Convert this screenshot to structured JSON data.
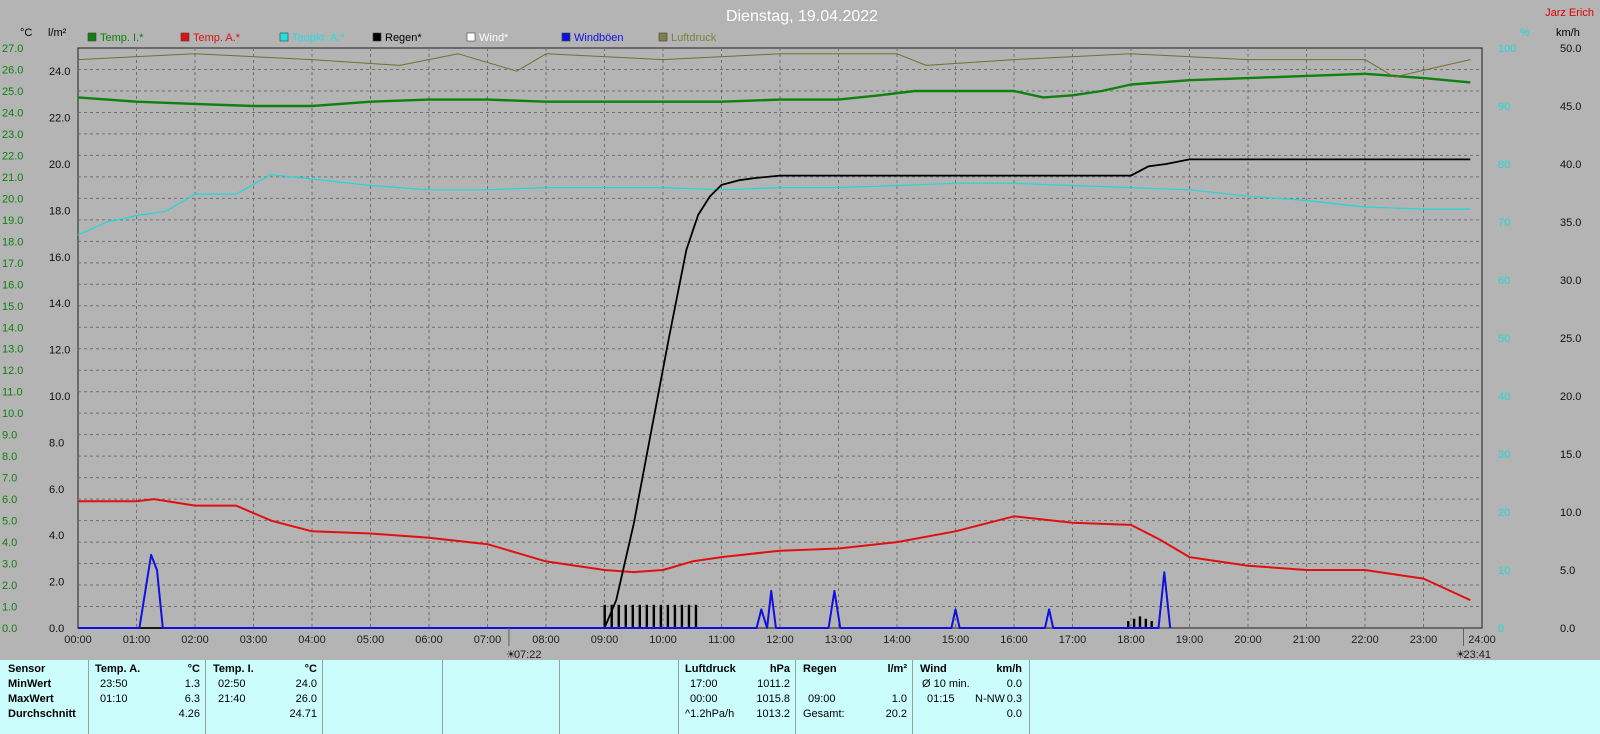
{
  "header": {
    "title": "Dienstag, 19.04.2022",
    "author": "Jarz Erich"
  },
  "legend": [
    {
      "label": "Temp. I.*",
      "color": "#108010"
    },
    {
      "label": "Temp. A.*",
      "color": "#e01010"
    },
    {
      "label": "Taupkt. A.*",
      "color": "#20e0e0"
    },
    {
      "label": "Regen*",
      "color": "#000000"
    },
    {
      "label": "Wind*",
      "color": "#ffffff"
    },
    {
      "label": "Windböen",
      "color": "#1010e0"
    },
    {
      "label": "Luftdruck",
      "color": "#808040"
    }
  ],
  "units": {
    "temp": "°C",
    "rain": "l/m²",
    "humidity": "%",
    "wind": "km/h"
  },
  "colors": {
    "temp_in": "#108010",
    "temp_out": "#e01010",
    "dew": "#20d8d8",
    "rain": "#000000",
    "gust": "#1010e0",
    "pressure": "#707030",
    "plot_bg": "#b4b4b4",
    "grid": "#707070"
  },
  "markers": {
    "sunrise": "07:22",
    "sunset": "23:41"
  },
  "chart_data": {
    "type": "line",
    "x_unit": "hour of day",
    "x_ticks": [
      "00:00",
      "01:00",
      "02:00",
      "03:00",
      "04:00",
      "05:00",
      "06:00",
      "07:00",
      "08:00",
      "09:00",
      "10:00",
      "11:00",
      "12:00",
      "13:00",
      "14:00",
      "15:00",
      "16:00",
      "17:00",
      "18:00",
      "19:00",
      "20:00",
      "21:00",
      "22:00",
      "23:00",
      "24:00"
    ],
    "axes": {
      "temp_ticks": [
        "27.0",
        "26.0",
        "25.0",
        "24.0",
        "23.0",
        "22.0",
        "21.0",
        "20.0",
        "19.0",
        "18.0",
        "17.0",
        "16.0",
        "15.0",
        "14.0",
        "13.0",
        "12.0",
        "11.0",
        "10.0",
        "9.0",
        "8.0",
        "7.0",
        "6.0",
        "5.0",
        "4.0",
        "3.0",
        "2.0",
        "1.0",
        "0.0"
      ],
      "rain_ticks": [
        "24.0",
        "22.0",
        "20.0",
        "18.0",
        "16.0",
        "14.0",
        "12.0",
        "10.0",
        "8.0",
        "6.0",
        "4.0",
        "2.0",
        "0.0"
      ],
      "humidity_ticks": [
        "100",
        "90",
        "80",
        "70",
        "60",
        "50",
        "40",
        "30",
        "20",
        "10",
        "0"
      ],
      "wind_ticks": [
        "50.0",
        "45.0",
        "40.0",
        "35.0",
        "30.0",
        "25.0",
        "20.0",
        "15.0",
        "10.0",
        "5.0",
        "0.0"
      ],
      "rain_range": [
        0,
        25
      ],
      "wind_range": [
        0,
        50
      ],
      "grid": true
    },
    "series": [
      {
        "name": "Temp. I.",
        "axis": "temp",
        "x": [
          0,
          1,
          2,
          3,
          4,
          5,
          6,
          7,
          8,
          9,
          10,
          11,
          12,
          13,
          13.7,
          14.3,
          15,
          16,
          16.5,
          17,
          17.5,
          18,
          19,
          20,
          21,
          22,
          23,
          23.8
        ],
        "y": [
          24.7,
          24.5,
          24.4,
          24.3,
          24.3,
          24.5,
          24.6,
          24.6,
          24.5,
          24.5,
          24.5,
          24.5,
          24.6,
          24.6,
          24.8,
          25.0,
          25.0,
          25.0,
          24.7,
          24.8,
          25.0,
          25.3,
          25.5,
          25.6,
          25.7,
          25.8,
          25.6,
          25.4
        ]
      },
      {
        "name": "Temp. A.",
        "axis": "temp",
        "x": [
          0,
          1,
          1.3,
          2,
          2.7,
          3.3,
          4,
          5,
          6,
          7,
          7.5,
          8,
          9,
          9.5,
          10,
          10.5,
          11,
          12,
          13,
          14,
          15,
          16,
          17,
          18,
          18.5,
          19,
          20,
          21,
          22,
          23,
          23.8
        ],
        "y": [
          5.9,
          5.9,
          6.0,
          5.7,
          5.7,
          5.0,
          4.5,
          4.4,
          4.2,
          3.9,
          3.5,
          3.1,
          2.7,
          2.6,
          2.7,
          3.1,
          3.3,
          3.6,
          3.7,
          4.0,
          4.5,
          5.2,
          4.9,
          4.8,
          4.1,
          3.3,
          2.9,
          2.7,
          2.7,
          2.3,
          1.3
        ]
      },
      {
        "name": "Taupkt. A.",
        "axis": "temp",
        "x": [
          0,
          0.5,
          1,
          1.5,
          2,
          2.7,
          3.3,
          4,
          5,
          6,
          7,
          8,
          9,
          10,
          11,
          12,
          13,
          14,
          15,
          16,
          17,
          18,
          19,
          20,
          21,
          22,
          23,
          23.8
        ],
        "y": [
          18.3,
          18.9,
          19.2,
          19.4,
          20.2,
          20.2,
          21.1,
          20.9,
          20.6,
          20.4,
          20.4,
          20.5,
          20.5,
          20.5,
          20.4,
          20.5,
          20.5,
          20.6,
          20.7,
          20.7,
          20.6,
          20.5,
          20.4,
          20.1,
          19.9,
          19.6,
          19.5,
          19.5
        ]
      },
      {
        "name": "Regen",
        "axis": "rain",
        "x": [
          0,
          9,
          9.2,
          9.5,
          9.8,
          10.1,
          10.4,
          10.6,
          10.8,
          11,
          11.3,
          11.6,
          12,
          13,
          14,
          15,
          16,
          17,
          18,
          18.3,
          18.6,
          19,
          20,
          21,
          22,
          23,
          23.8
        ],
        "y": [
          0,
          0,
          1.2,
          4.5,
          8.5,
          12.5,
          16.3,
          17.8,
          18.6,
          19.1,
          19.3,
          19.4,
          19.5,
          19.5,
          19.5,
          19.5,
          19.5,
          19.5,
          19.5,
          19.9,
          20.0,
          20.2,
          20.2,
          20.2,
          20.2,
          20.2,
          20.2
        ]
      },
      {
        "name": "Windböen",
        "axis": "wind",
        "x": [
          0,
          1.05,
          1.25,
          1.35,
          1.45,
          11.6,
          11.68,
          11.78,
          11.85,
          11.93,
          12.83,
          12.93,
          13.03,
          14.93,
          15.0,
          15.07,
          16.53,
          16.6,
          16.67,
          18.47,
          18.57,
          18.67
        ],
        "y": [
          0,
          0,
          6.3,
          5.0,
          0,
          0,
          1.6,
          0,
          3.2,
          0,
          0,
          3.2,
          0,
          0,
          1.6,
          0,
          0,
          1.6,
          0,
          0,
          4.8,
          0
        ]
      },
      {
        "name": "Luftdruck",
        "axis": "humidity",
        "x": [
          0,
          2,
          4,
          5.5,
          6.5,
          7.5,
          8,
          10,
          12,
          14,
          14.5,
          16,
          18,
          20,
          22,
          22.5,
          23.8
        ],
        "y": [
          98,
          99,
          98,
          97,
          99,
          96,
          99,
          98,
          99,
          99,
          97,
          98,
          99,
          98,
          98,
          95,
          98
        ]
      }
    ],
    "rain_bars": {
      "x": [
        9.0,
        9.12,
        9.24,
        9.36,
        9.48,
        9.6,
        9.72,
        9.84,
        9.96,
        10.08,
        10.2,
        10.32,
        10.44,
        10.56,
        17.95,
        18.05,
        18.15,
        18.25,
        18.35
      ],
      "y": [
        1.0,
        1.0,
        1.0,
        1.0,
        1.0,
        1.0,
        1.0,
        1.0,
        1.0,
        1.0,
        1.0,
        1.0,
        1.0,
        1.0,
        0.3,
        0.4,
        0.5,
        0.4,
        0.3
      ]
    }
  },
  "panel": {
    "col1": {
      "header": "Sensor",
      "rows": [
        "MinWert",
        "MaxWert",
        "Durchschnitt"
      ]
    },
    "col2": {
      "header": "Temp. A.",
      "unit": "°C",
      "times": [
        "23:50",
        "01:10",
        ""
      ],
      "values": [
        "1.3",
        "6.3",
        "4.26"
      ]
    },
    "col3": {
      "header": "Temp. I.",
      "unit": "°C",
      "times": [
        "02:50",
        "21:40",
        ""
      ],
      "values": [
        "24.0",
        "26.0",
        "24.71"
      ]
    },
    "col4": {
      "header": "Luftdruck",
      "unit": "hPa",
      "times": [
        "17:00",
        "00:00",
        "^1.2hPa/h"
      ],
      "values": [
        "1011.2",
        "1015.8",
        "1013.2"
      ]
    },
    "col5": {
      "header": "Regen",
      "unit": "l/m²",
      "times": [
        "",
        "09:00",
        "Gesamt:"
      ],
      "values": [
        "",
        "1.0",
        "20.2"
      ]
    },
    "col6": {
      "header": "Wind",
      "unit": "km/h",
      "times": [
        "Ø 10 min.",
        "01:15",
        ""
      ],
      "dirs": [
        "",
        "N-NW",
        ""
      ],
      "values": [
        "0.0",
        "0.3",
        "0.0"
      ]
    }
  }
}
